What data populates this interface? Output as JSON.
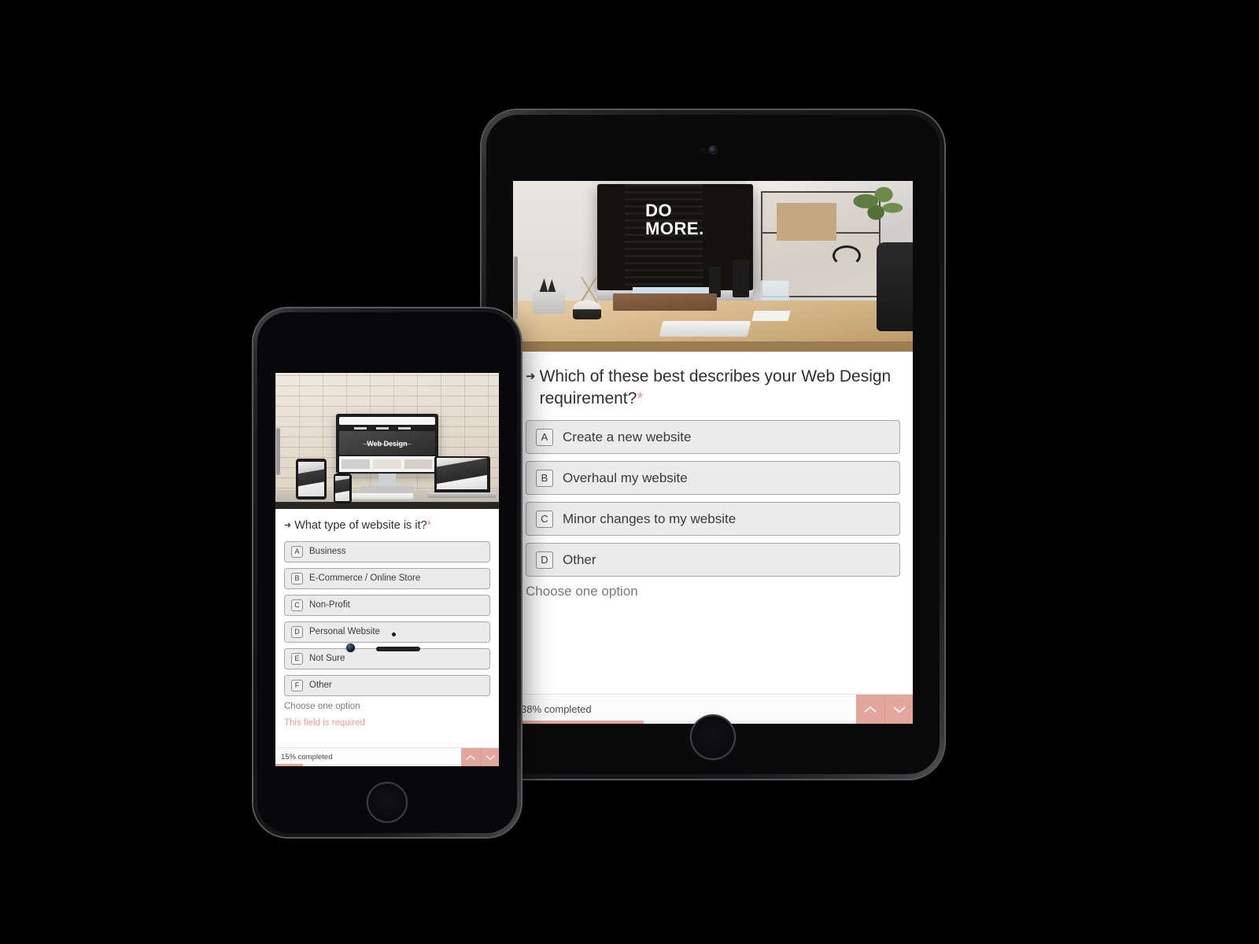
{
  "tablet": {
    "hero": {
      "alt": "office-desk-photo",
      "monitor_text_line1": "DO",
      "monitor_text_line2": "MORE."
    },
    "question": {
      "arrow": "➜",
      "text": "Which of these best describes your Web Design requirement?",
      "required_marker": "*"
    },
    "options": [
      {
        "key": "A",
        "label": "Create a new website"
      },
      {
        "key": "B",
        "label": "Overhaul my website"
      },
      {
        "key": "C",
        "label": "Minor changes to my website"
      },
      {
        "key": "D",
        "label": "Other"
      }
    ],
    "hint": "Choose one option",
    "footer": {
      "progress_text": "38% completed",
      "progress_percent": 38,
      "prev_icon": "chevron-up",
      "next_icon": "chevron-down"
    }
  },
  "phone": {
    "hero": {
      "alt": "responsive-web-design-mockup",
      "screen_title": "Web Design"
    },
    "question": {
      "arrow": "➜",
      "text": "What type of website is it?",
      "required_marker": "*"
    },
    "options": [
      {
        "key": "A",
        "label": "Business"
      },
      {
        "key": "B",
        "label": "E-Commerce / Online Store"
      },
      {
        "key": "C",
        "label": "Non-Profit"
      },
      {
        "key": "D",
        "label": "Personal Website"
      },
      {
        "key": "E",
        "label": "Not Sure"
      },
      {
        "key": "F",
        "label": "Other"
      }
    ],
    "hint": "Choose one option",
    "error": "This field is required",
    "footer": {
      "progress_text": "15% completed",
      "progress_percent": 15,
      "prev_icon": "chevron-up",
      "next_icon": "chevron-down"
    }
  },
  "colors": {
    "accent": "#e3a79d",
    "required": "#e8968c",
    "error": "#ef9a90",
    "option_bg": "#ebebeb",
    "option_border": "#a9a9a9",
    "page_bg": "#000000"
  }
}
